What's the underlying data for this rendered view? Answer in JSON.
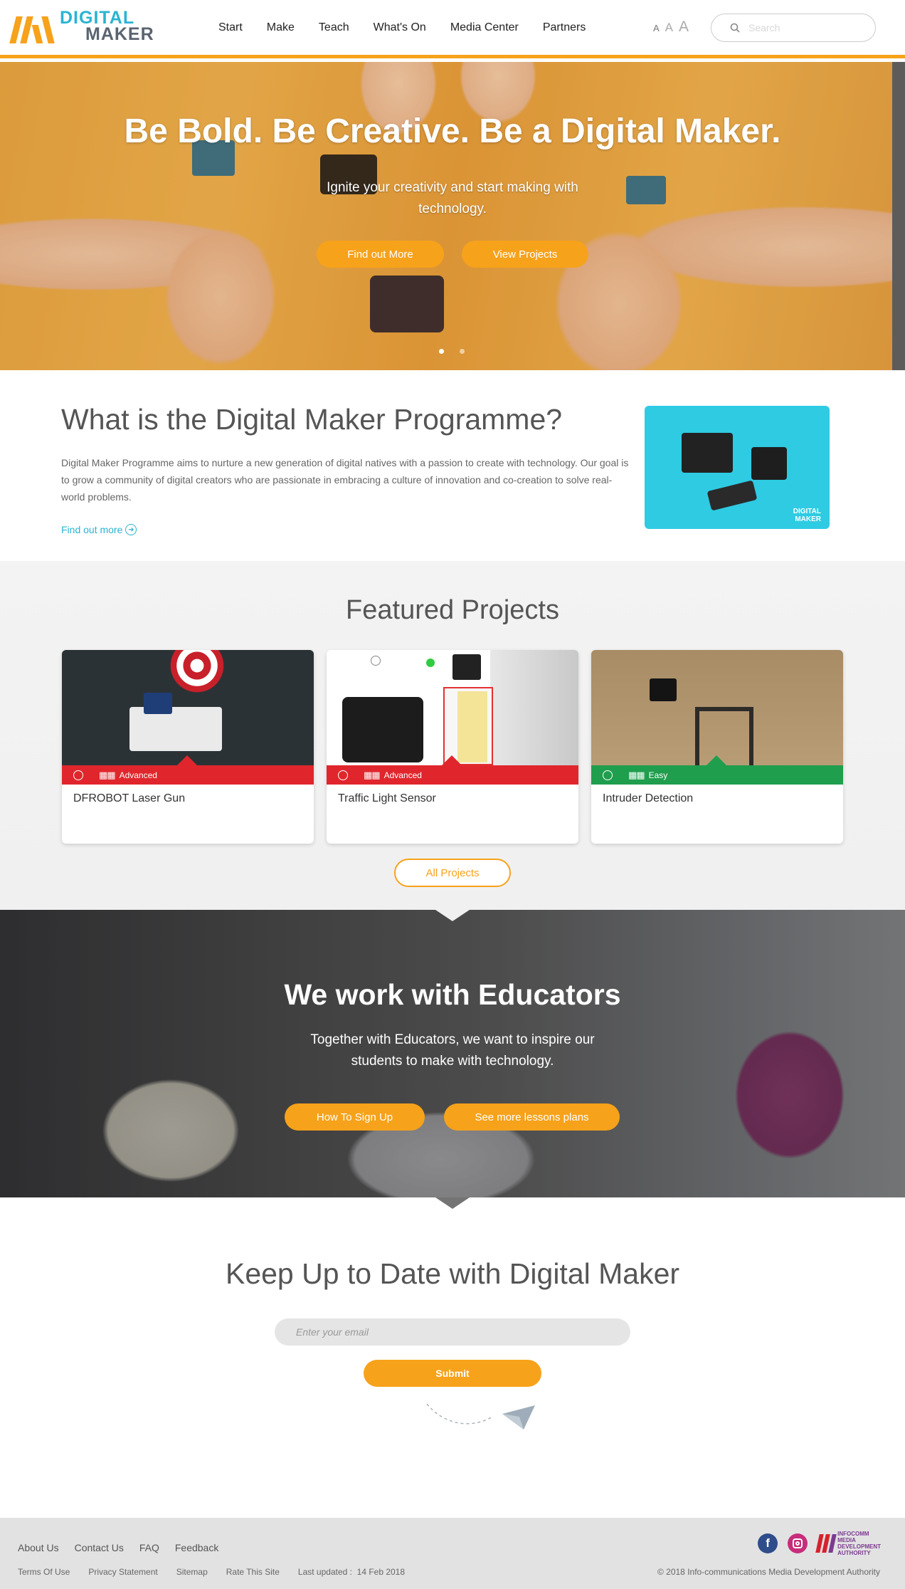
{
  "header": {
    "logo_line1": "DIGITAL",
    "logo_line2": "MAKER",
    "nav": [
      "Start",
      "Make",
      "Teach",
      "What's On",
      "Media Center",
      "Partners"
    ],
    "font_sizes": [
      "A",
      "A",
      "A"
    ],
    "search_placeholder": "Search"
  },
  "hero": {
    "title": "Be Bold. Be Creative. Be a Digital Maker.",
    "subtitle": "Ignite your creativity and start making with technology.",
    "btn_find": "Find out More",
    "btn_view": "View Projects",
    "slide_count": 2,
    "active_slide": 1
  },
  "programme": {
    "title": "What is the Digital Maker Programme?",
    "body": "Digital Maker Programme aims to nurture a new generation of digital natives with a passion to create with technology. Our goal is to grow a community of digital creators who are passionate in embracing a culture of innovation and co-creation to solve real-world problems.",
    "link": "Find out more",
    "image_watermark_1": "DIGITAL",
    "image_watermark_2": "MAKER"
  },
  "featured": {
    "title": "Featured Projects",
    "projects": [
      {
        "title": "DFROBOT Laser Gun",
        "level": "Advanced",
        "color": "#e0262c"
      },
      {
        "title": "Traffic Light Sensor",
        "level": "Advanced",
        "color": "#e0262c"
      },
      {
        "title": "Intruder Detection",
        "level": "Easy",
        "color": "#1f9e4d"
      }
    ],
    "all_button": "All Projects"
  },
  "educators": {
    "title": "We work with Educators",
    "subtitle": "Together with Educators, we want to inspire our students to make with technology.",
    "btn_signup": "How To Sign Up",
    "btn_lessons": "See more lessons plans"
  },
  "newsletter": {
    "title": "Keep Up to Date with Digital Maker",
    "email_placeholder": "Enter your email",
    "submit": "Submit"
  },
  "footer": {
    "links": [
      "About Us",
      "Contact Us",
      "FAQ",
      "Feedback"
    ],
    "small_links": [
      "Terms Of Use",
      "Privacy Statement",
      "Sitemap",
      "Rate This Site"
    ],
    "last_updated_label": "Last updated :",
    "last_updated": "14 Feb 2018",
    "copyright": "© 2018 Info-communications Media Development Authority",
    "imda_text": [
      "INFOCOMM",
      "MEDIA",
      "DEVELOPMENT",
      "AUTHORITY"
    ]
  },
  "colors": {
    "accent": "#f7a21b",
    "link": "#2ab4d2",
    "advanced": "#e0262c",
    "easy": "#1f9e4d"
  }
}
